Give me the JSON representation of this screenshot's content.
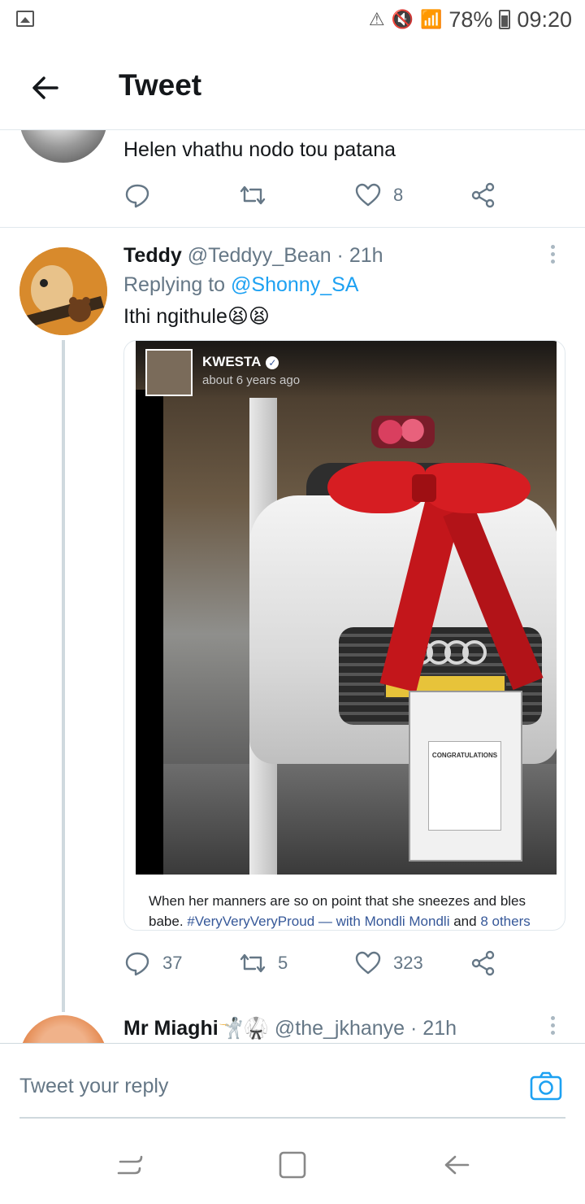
{
  "status_bar": {
    "battery": "78%",
    "time": "09:20"
  },
  "header": {
    "title": "Tweet"
  },
  "previous_tweet": {
    "text": "Helen vhathu nodo tou patana",
    "like_count": "8"
  },
  "main_tweet": {
    "display_name": "Teddy",
    "handle": "@Teddyy_Bean · 21h",
    "replying_prefix": "Replying to",
    "replying_to": "@Shonny_SA",
    "text": "Ithi ngithule😫😫",
    "media": {
      "fb_name": "KWESTA",
      "fb_time": "about 6 years ago",
      "sign_title": "CONGRATULATIONS",
      "caption_line1": "When her manners are so on point that she sneezes and bles",
      "caption_line2_start": "babe.",
      "caption_hashtag": "#VeryVeryVeryProud",
      "caption_with": "— with",
      "caption_person": "Mondli Mondli",
      "caption_and": "and",
      "caption_others": "8 others"
    },
    "reply_count": "37",
    "retweet_count": "5",
    "like_count": "323"
  },
  "next_tweet": {
    "display_name": "Mr Miaghi🤺🥋",
    "handle": "@the_jkhanye · 21h"
  },
  "reply_bar": {
    "placeholder": "Tweet your reply"
  },
  "colors": {
    "twitter_blue": "#1da1f2",
    "secondary_text": "#657786",
    "divider": "#e1e8ed"
  }
}
